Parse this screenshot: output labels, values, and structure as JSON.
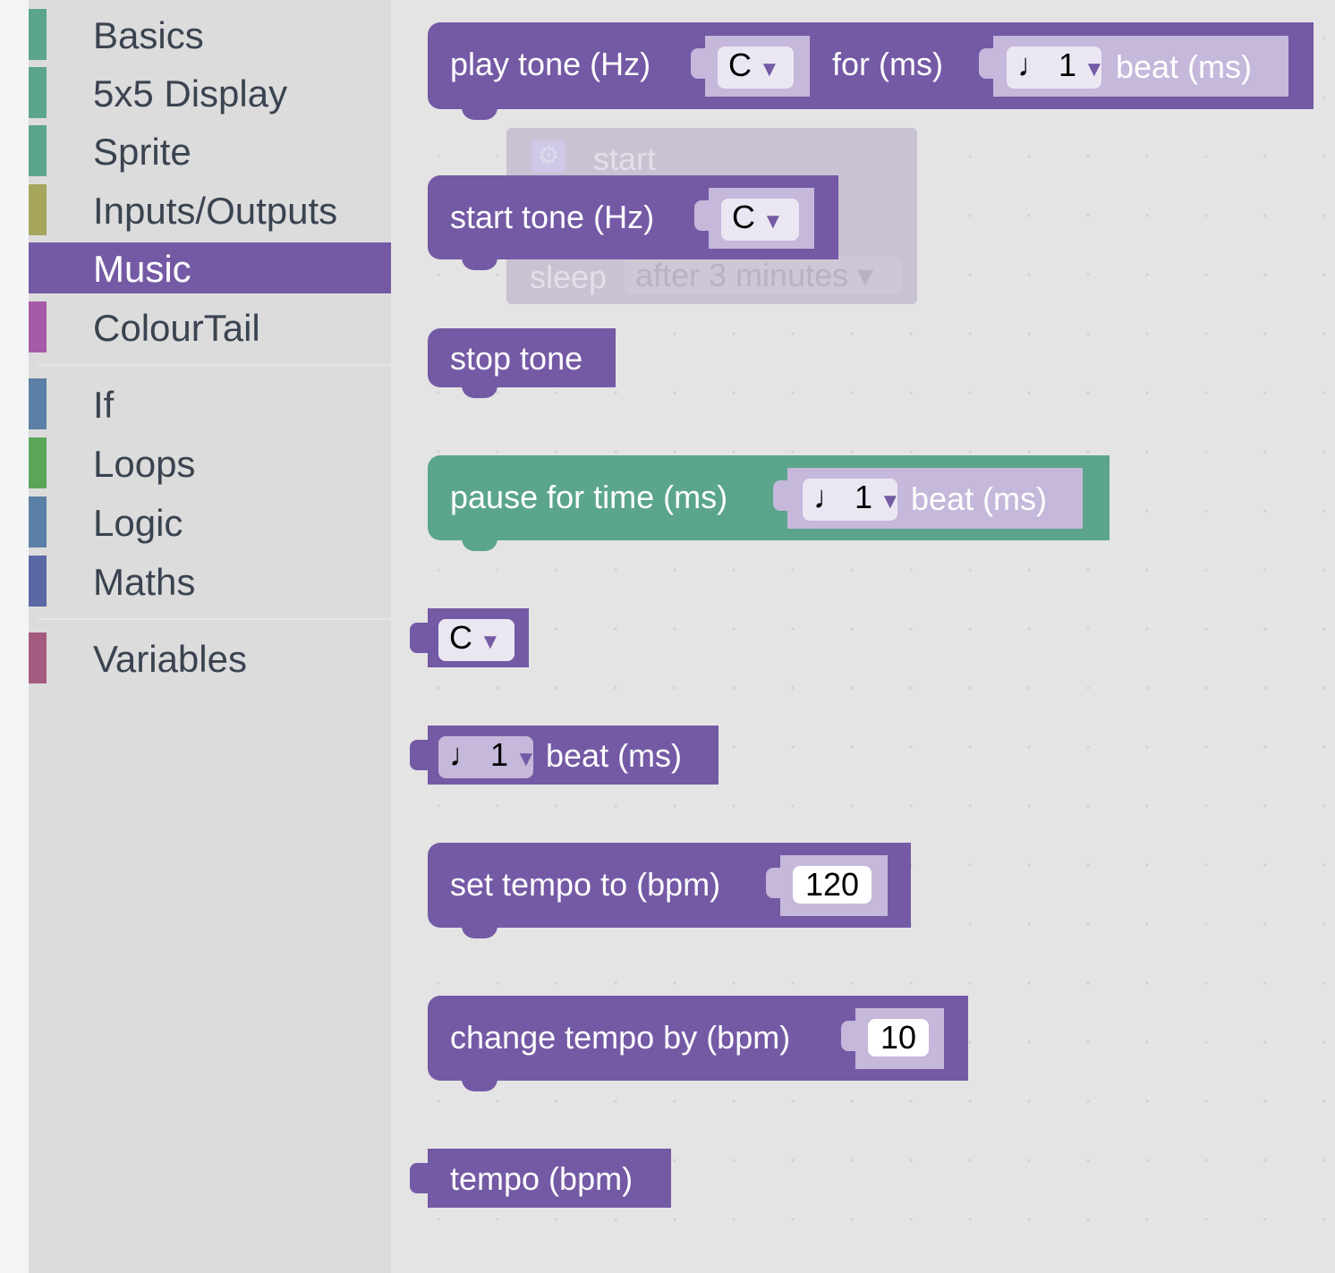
{
  "sidebar": {
    "items": [
      {
        "label": "Basics",
        "color": "#5ba58c"
      },
      {
        "label": "5x5 Display",
        "color": "#5ba58c"
      },
      {
        "label": "Sprite",
        "color": "#5ba58c"
      },
      {
        "label": "Inputs/Outputs",
        "color": "#a5a55b"
      },
      {
        "label": "Music",
        "color": "#745aa5",
        "selected": true
      },
      {
        "label": "ColourTail",
        "color": "#a55ba5"
      },
      {
        "label": "If",
        "color": "#5b80a5"
      },
      {
        "label": "Loops",
        "color": "#5ba55b"
      },
      {
        "label": "Logic",
        "color": "#5b80a5"
      },
      {
        "label": "Maths",
        "color": "#5b67a5"
      },
      {
        "label": "Variables",
        "color": "#a55b80"
      }
    ]
  },
  "ghost": {
    "start": "start",
    "sleep": "sleep",
    "sleep_option": "after 3 minutes",
    "icon": "gear-icon"
  },
  "blocks": {
    "play_tone": {
      "label": "play tone (Hz)",
      "note": "C",
      "for": "for (ms)",
      "beat": "♩ 1",
      "beat_label": "beat (ms)"
    },
    "start_tone": {
      "label": "start tone (Hz)",
      "note": "C"
    },
    "stop_tone": {
      "label": "stop tone"
    },
    "pause": {
      "label": "pause for time (ms)",
      "beat": "♩ 1",
      "beat_label": "beat (ms)"
    },
    "note": {
      "note": "C"
    },
    "beat": {
      "beat": "♩ 1",
      "beat_label": "beat (ms)"
    },
    "set_tempo": {
      "label": "set tempo to (bpm)",
      "value": "120"
    },
    "change_tempo": {
      "label": "change tempo by (bpm)",
      "value": "10"
    },
    "tempo": {
      "label": "tempo (bpm)"
    }
  },
  "colors": {
    "music": "#745aa5",
    "pause": "#5ba58c",
    "slot": "#c5b8db"
  }
}
